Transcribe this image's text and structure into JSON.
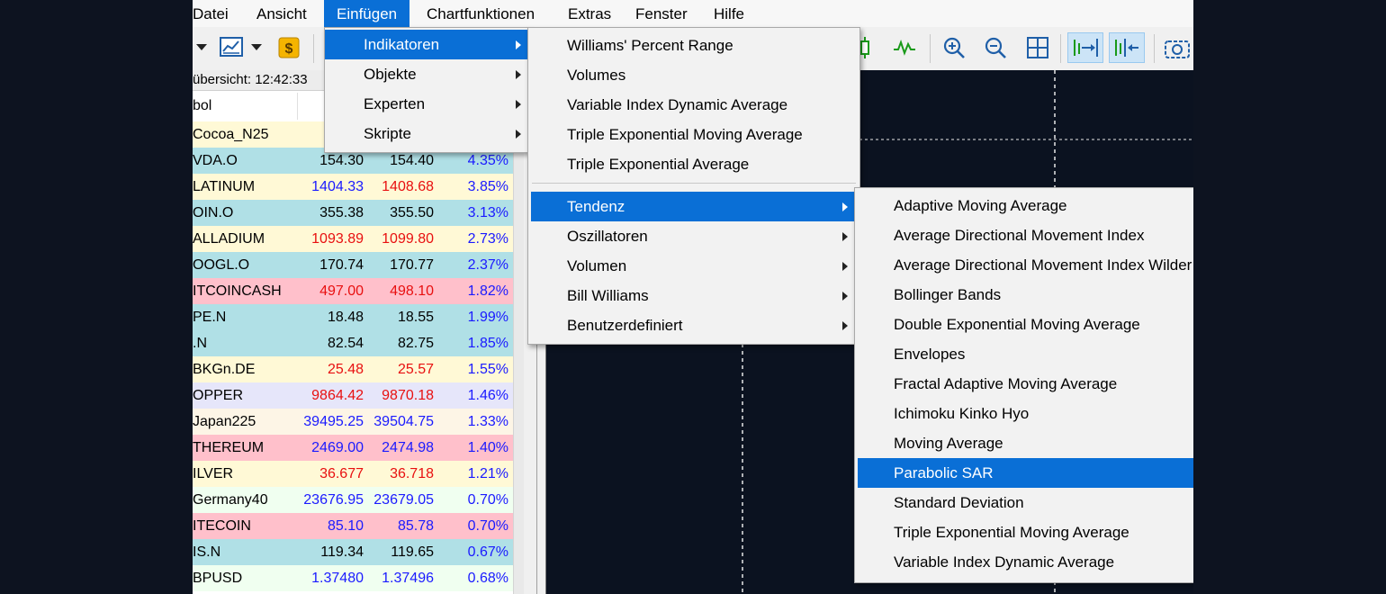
{
  "menubar": {
    "items": [
      "Datei",
      "Ansicht",
      "Einfügen",
      "Chartfunktionen",
      "Extras",
      "Fenster",
      "Hilfe"
    ],
    "active": "Einfügen"
  },
  "market_watch": {
    "header": "übersicht: 12:42:33",
    "col_symbol": "bol",
    "rows": [
      {
        "symbol": "Cocoa_N25",
        "bid": "",
        "ask": "",
        "change": "",
        "bg": "#fff9d6",
        "color": "#000000",
        "chg_color": "#1a1aff"
      },
      {
        "symbol": "VDA.O",
        "bid": "154.30",
        "ask": "154.40",
        "change": "4.35%",
        "bg": "#b0e0e6",
        "color": "#000000",
        "chg_color": "#1a1aff"
      },
      {
        "symbol": "LATINUM",
        "bid": "1404.33",
        "ask": "1408.68",
        "change": "3.85%",
        "bg": "#fff9d6",
        "color": "#1a1aff",
        "ask_color": "#e81010",
        "chg_color": "#1a1aff"
      },
      {
        "symbol": "OIN.O",
        "bid": "355.38",
        "ask": "355.50",
        "change": "3.13%",
        "bg": "#b0e0e6",
        "color": "#000000",
        "chg_color": "#1a1aff"
      },
      {
        "symbol": "ALLADIUM",
        "bid": "1093.89",
        "ask": "1099.80",
        "change": "2.73%",
        "bg": "#fff9d6",
        "color": "#e81010",
        "chg_color": "#1a1aff"
      },
      {
        "symbol": "OOGL.O",
        "bid": "170.74",
        "ask": "170.77",
        "change": "2.37%",
        "bg": "#b0e0e6",
        "color": "#000000",
        "chg_color": "#1a1aff"
      },
      {
        "symbol": "ITCOINCASH",
        "bid": "497.00",
        "ask": "498.10",
        "change": "1.82%",
        "bg": "#ffc0cb",
        "color": "#e81010",
        "chg_color": "#1a1aff"
      },
      {
        "symbol": "PE.N",
        "bid": "18.48",
        "ask": "18.55",
        "change": "1.99%",
        "bg": "#b0e0e6",
        "color": "#000000",
        "chg_color": "#1a1aff"
      },
      {
        "symbol": ".N",
        "bid": "82.54",
        "ask": "82.75",
        "change": "1.85%",
        "bg": "#b0e0e6",
        "color": "#000000",
        "chg_color": "#1a1aff"
      },
      {
        "symbol": "BKGn.DE",
        "bid": "25.48",
        "ask": "25.57",
        "change": "1.55%",
        "bg": "#fff9d6",
        "color": "#e81010",
        "chg_color": "#1a1aff"
      },
      {
        "symbol": "OPPER",
        "bid": "9864.42",
        "ask": "9870.18",
        "change": "1.46%",
        "bg": "#e6e6fa",
        "color": "#e81010",
        "chg_color": "#1a1aff"
      },
      {
        "symbol": "Japan225",
        "bid": "39495.25",
        "ask": "39504.75",
        "change": "1.33%",
        "bg": "#fdf5e6",
        "color": "#1a1aff",
        "chg_color": "#1a1aff"
      },
      {
        "symbol": "THEREUM",
        "bid": "2469.00",
        "ask": "2474.98",
        "change": "1.40%",
        "bg": "#ffc0cb",
        "color": "#1a1aff",
        "chg_color": "#1a1aff"
      },
      {
        "symbol": "ILVER",
        "bid": "36.677",
        "ask": "36.718",
        "change": "1.21%",
        "bg": "#fff9d6",
        "color": "#e81010",
        "chg_color": "#1a1aff"
      },
      {
        "symbol": "Germany40",
        "bid": "23676.95",
        "ask": "23679.05",
        "change": "0.70%",
        "bg": "#f0fff0",
        "color": "#1a1aff",
        "chg_color": "#1a1aff"
      },
      {
        "symbol": "ITECOIN",
        "bid": "85.10",
        "ask": "85.78",
        "change": "0.70%",
        "bg": "#ffc0cb",
        "color": "#1a1aff",
        "chg_color": "#1a1aff"
      },
      {
        "symbol": "IS.N",
        "bid": "119.34",
        "ask": "119.65",
        "change": "0.67%",
        "bg": "#b0e0e6",
        "color": "#000000",
        "chg_color": "#1a1aff"
      },
      {
        "symbol": "BPUSD",
        "bid": "1.37480",
        "ask": "1.37496",
        "change": "0.68%",
        "bg": "#f0fff0",
        "color": "#1a1aff",
        "chg_color": "#1a1aff"
      }
    ]
  },
  "menu_einfuegen": {
    "items": [
      {
        "label": "Indikatoren",
        "submenu": true,
        "highlighted": true
      },
      {
        "label": "Objekte",
        "submenu": true
      },
      {
        "label": "Experten",
        "submenu": true
      },
      {
        "label": "Skripte",
        "submenu": true
      }
    ]
  },
  "menu_indikatoren": {
    "items_top": [
      "Williams' Percent Range",
      "Volumes",
      "Variable Index Dynamic Average",
      "Triple Exponential Moving Average",
      "Triple Exponential Average"
    ],
    "items_groups": [
      {
        "label": "Tendenz",
        "submenu": true,
        "highlighted": true
      },
      {
        "label": "Oszillatoren",
        "submenu": true
      },
      {
        "label": "Volumen",
        "submenu": true
      },
      {
        "label": "Bill Williams",
        "submenu": true
      },
      {
        "label": "Benutzerdefiniert",
        "submenu": true
      }
    ]
  },
  "menu_tendenz": {
    "items": [
      "Adaptive Moving Average",
      "Average Directional Movement Index",
      "Average Directional Movement Index Wilder",
      "Bollinger Bands",
      "Double Exponential Moving Average",
      "Envelopes",
      "Fractal Adaptive Moving Average",
      "Ichimoku Kinko Hyo",
      "Moving Average",
      "Parabolic SAR",
      "Standard Deviation",
      "Triple Exponential Moving Average",
      "Variable Index Dynamic Average"
    ],
    "highlighted": "Parabolic SAR"
  },
  "colors": {
    "accent": "#0a6fd6",
    "chart_bg": "#0b1220",
    "page_bg": "#0d1320",
    "menu_bg": "#f2f2f2"
  }
}
